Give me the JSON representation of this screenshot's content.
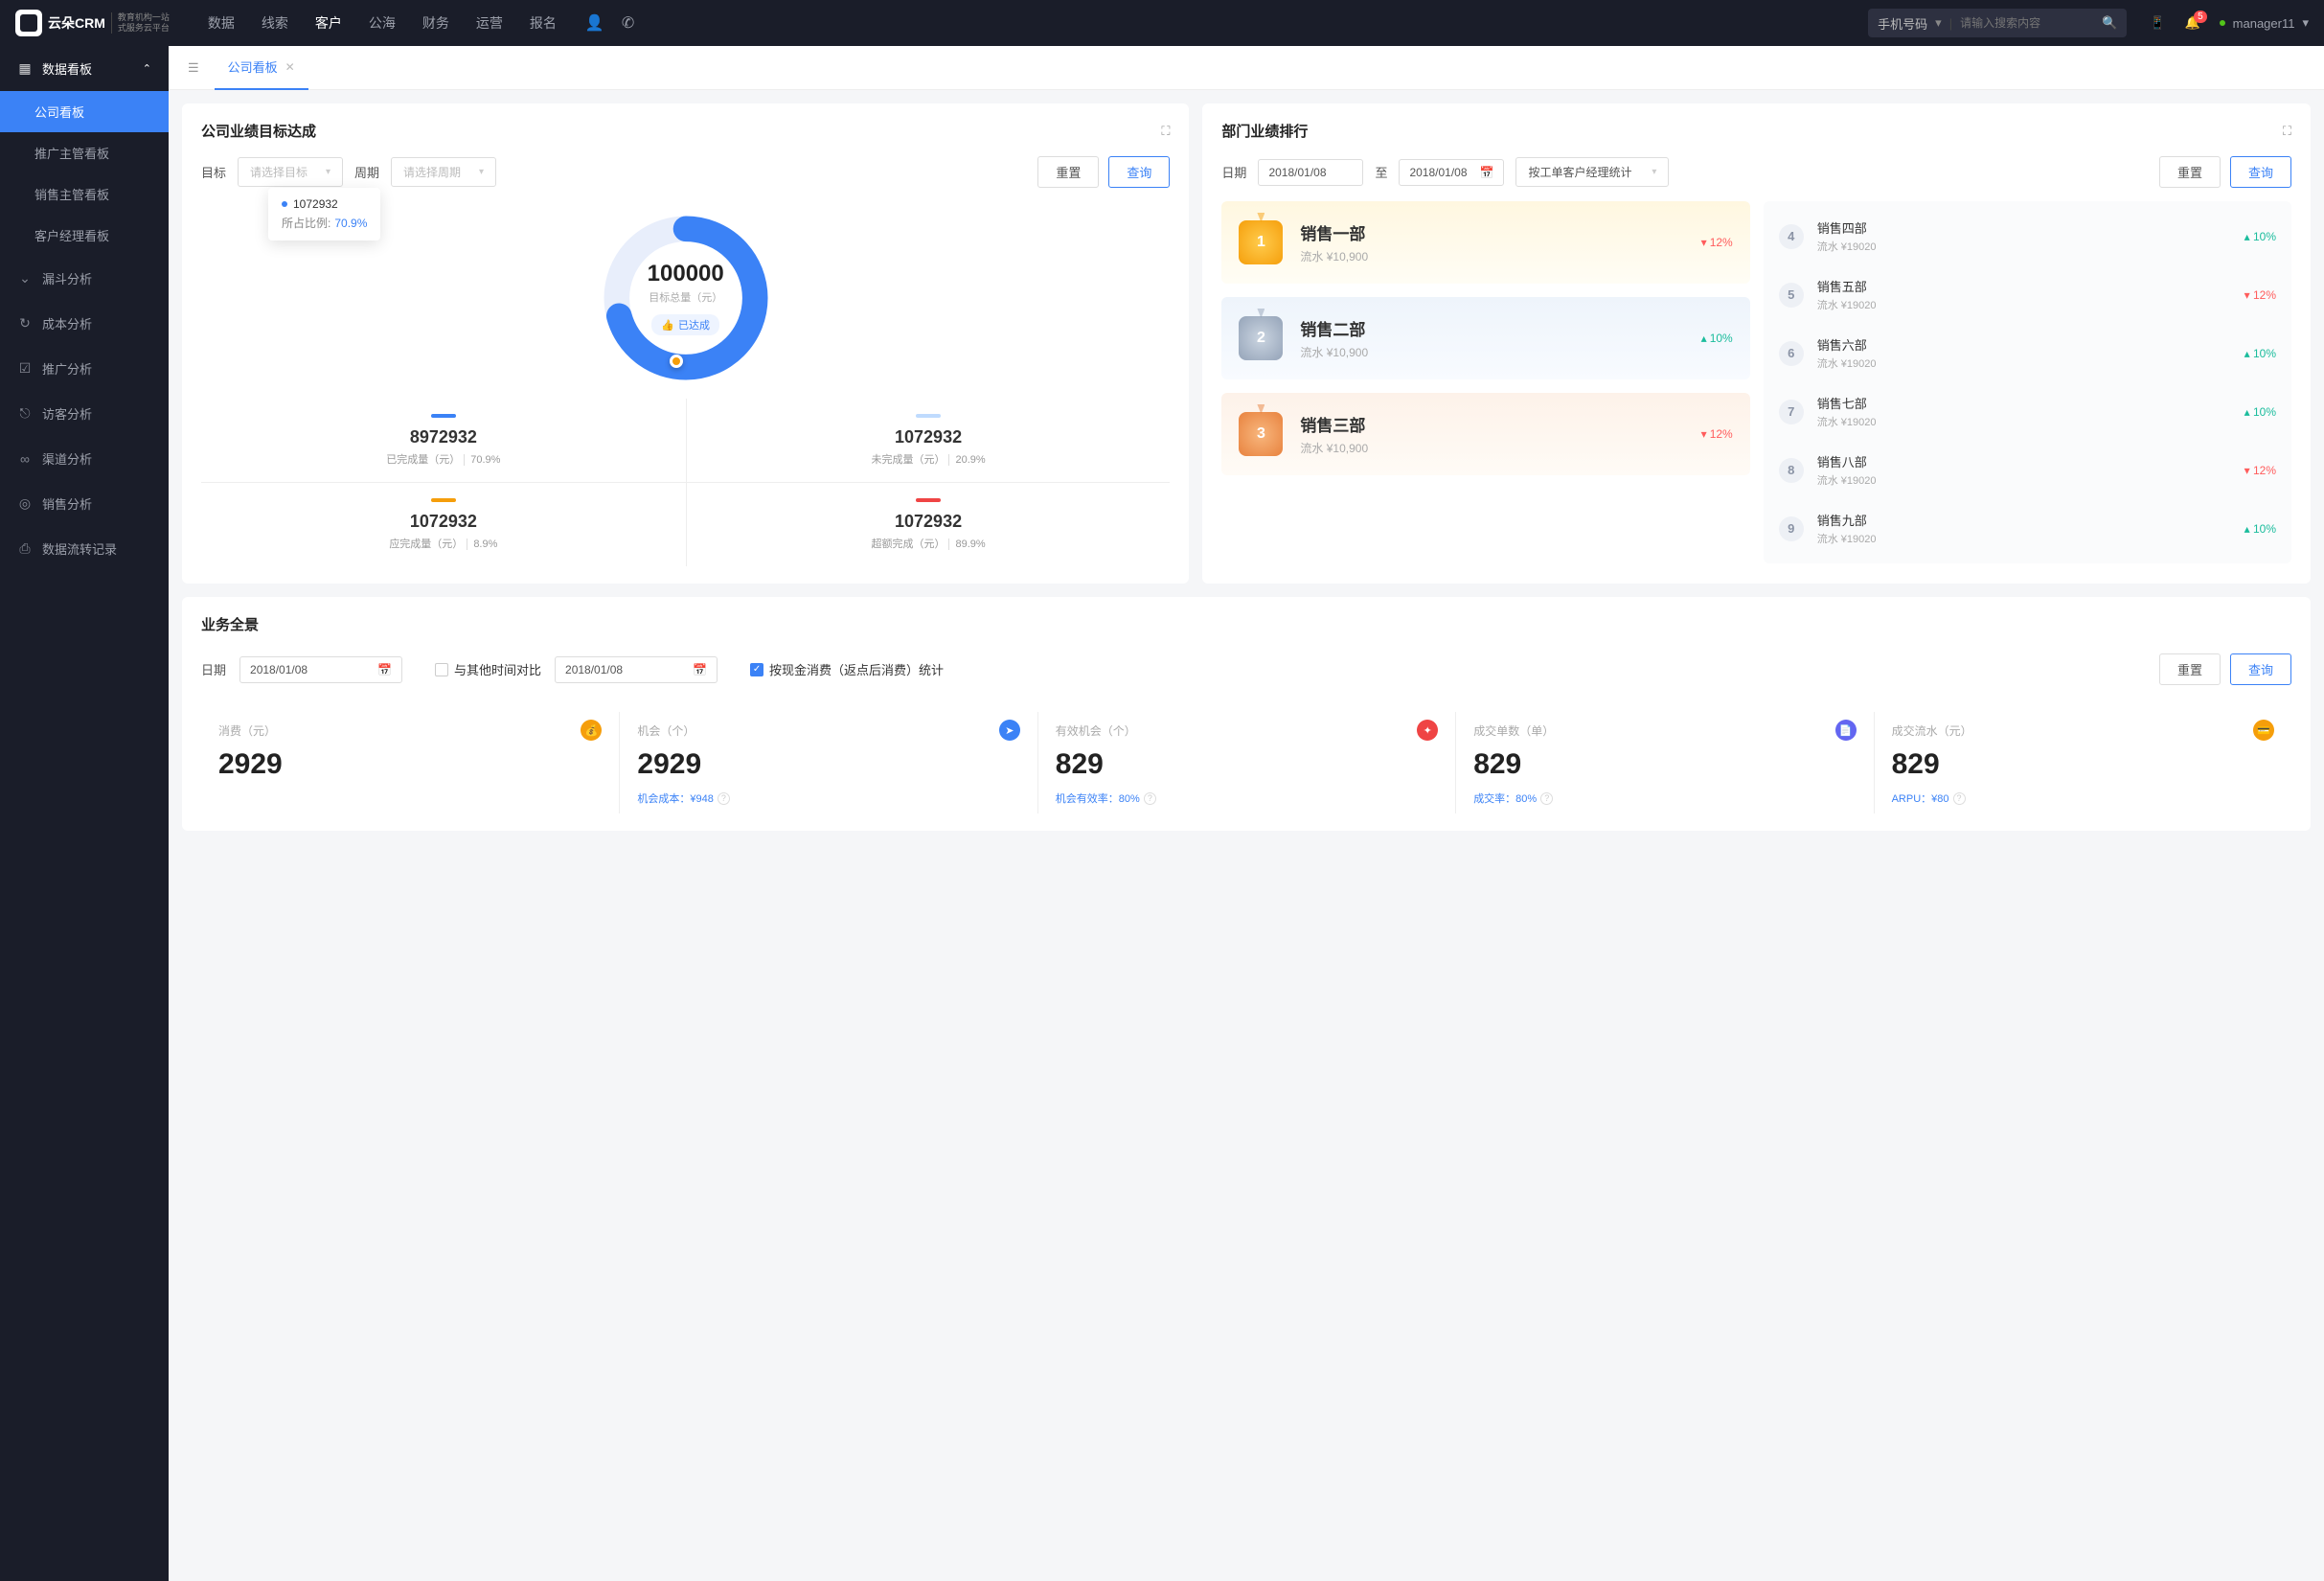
{
  "brand": {
    "name": "云朵CRM",
    "sub1": "教育机构一站",
    "sub2": "式服务云平台"
  },
  "topnav": [
    "数据",
    "线索",
    "客户",
    "公海",
    "财务",
    "运营",
    "报名"
  ],
  "topnav_active": 2,
  "search": {
    "type": "手机号码",
    "placeholder": "请输入搜索内容"
  },
  "notif_count": "5",
  "username": "manager11",
  "sidebar": {
    "group_title": "数据看板",
    "items": [
      "公司看板",
      "推广主管看板",
      "销售主管看板",
      "客户经理看板"
    ],
    "roots": [
      "漏斗分析",
      "成本分析",
      "推广分析",
      "访客分析",
      "渠道分析",
      "销售分析",
      "数据流转记录"
    ]
  },
  "tab": {
    "label": "公司看板"
  },
  "target_card": {
    "title": "公司业绩目标达成",
    "lbl_target": "目标",
    "ph_target": "请选择目标",
    "lbl_period": "周期",
    "ph_period": "请选择周期",
    "btn_reset": "重置",
    "btn_query": "查询",
    "tooltip_val": "1072932",
    "tooltip_lbl": "所占比例:",
    "tooltip_pct": "70.9%",
    "center_val": "100000",
    "center_sub": "目标总量（元）",
    "center_tag": "已达成",
    "m1_val": "8972932",
    "m1_lbl": "已完成量（元）",
    "m1_pct": "70.9%",
    "m2_val": "1072932",
    "m2_lbl": "未完成量（元）",
    "m2_pct": "20.9%",
    "m3_val": "1072932",
    "m3_lbl": "应完成量（元）",
    "m3_pct": "8.9%",
    "m4_val": "1072932",
    "m4_lbl": "超额完成（元）",
    "m4_pct": "89.9%"
  },
  "rank_card": {
    "title": "部门业绩排行",
    "lbl_date": "日期",
    "date_from": "2018/01/08",
    "date_to": "2018/01/08",
    "date_sep": "至",
    "group_by": "按工单客户经理统计",
    "btn_reset": "重置",
    "btn_query": "查询",
    "top3": [
      {
        "name": "销售一部",
        "sub": "流水 ¥10,900",
        "delta": "12%",
        "dir": "down"
      },
      {
        "name": "销售二部",
        "sub": "流水 ¥10,900",
        "delta": "10%",
        "dir": "up"
      },
      {
        "name": "销售三部",
        "sub": "流水 ¥10,900",
        "delta": "12%",
        "dir": "down"
      }
    ],
    "rest": [
      {
        "n": "4",
        "name": "销售四部",
        "sub": "流水 ¥19020",
        "delta": "10%",
        "dir": "up"
      },
      {
        "n": "5",
        "name": "销售五部",
        "sub": "流水 ¥19020",
        "delta": "12%",
        "dir": "down"
      },
      {
        "n": "6",
        "name": "销售六部",
        "sub": "流水 ¥19020",
        "delta": "10%",
        "dir": "up"
      },
      {
        "n": "7",
        "name": "销售七部",
        "sub": "流水 ¥19020",
        "delta": "10%",
        "dir": "up"
      },
      {
        "n": "8",
        "name": "销售八部",
        "sub": "流水 ¥19020",
        "delta": "12%",
        "dir": "down"
      },
      {
        "n": "9",
        "name": "销售九部",
        "sub": "流水 ¥19020",
        "delta": "10%",
        "dir": "up"
      }
    ]
  },
  "panorama": {
    "title": "业务全景",
    "lbl_date": "日期",
    "date1": "2018/01/08",
    "compare_label": "与其他时间对比",
    "date2": "2018/01/08",
    "cash_label": "按现金消费（返点后消费）统计",
    "btn_reset": "重置",
    "btn_query": "查询",
    "kpis": [
      {
        "label": "消费（元）",
        "val": "2929",
        "foot": "",
        "color": "#f59e0b",
        "icon": "💰"
      },
      {
        "label": "机会（个）",
        "val": "2929",
        "foot": "机会成本：¥948",
        "color": "#3b82f6",
        "icon": "➤"
      },
      {
        "label": "有效机会（个）",
        "val": "829",
        "foot": "机会有效率：80%",
        "color": "#ef4444",
        "icon": "✦"
      },
      {
        "label": "成交单数（单）",
        "val": "829",
        "foot": "成交率：80%",
        "color": "#6366f1",
        "icon": "📄"
      },
      {
        "label": "成交流水（元）",
        "val": "829",
        "foot": "ARPU：¥80",
        "color": "#f59e0b",
        "icon": "💳"
      }
    ]
  },
  "chart_data": {
    "type": "pie",
    "title": "目标总量（元）",
    "total": 100000,
    "series": [
      {
        "name": "已完成量（元）",
        "value": 8972932,
        "pct": 70.9,
        "color": "#3b82f6"
      },
      {
        "name": "未完成量（元）",
        "value": 1072932,
        "pct": 20.9,
        "color": "#bfdbfe"
      },
      {
        "name": "应完成量（元）",
        "value": 1072932,
        "pct": 8.9,
        "color": "#f59e0b"
      },
      {
        "name": "超额完成（元）",
        "value": 1072932,
        "pct": 89.9,
        "color": "#ef4444"
      }
    ]
  }
}
